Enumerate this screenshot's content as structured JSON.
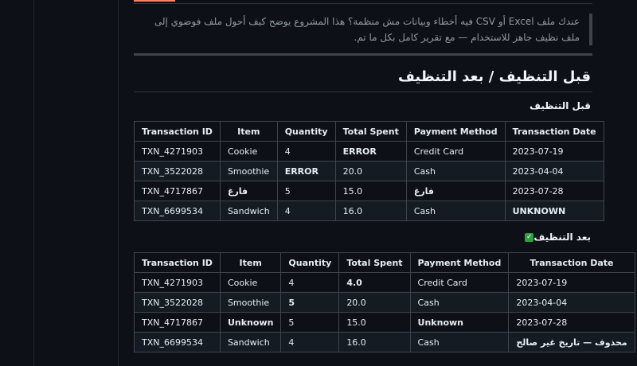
{
  "intro": "عندك ملف Excel أو CSV فيه أخطاء وبيانات مش منظمة؟ هذا المشروع يوضح كيف أحول ملف فوضوي إلى ملف نظيف جاهز للاستخدام — مع تقرير كامل بكل ما تم.",
  "section_title": "قبل التنظيف / بعد التنظيف",
  "before": {
    "label": "قبل التنظيف",
    "headers": [
      "Transaction ID",
      "Item",
      "Quantity",
      "Total Spent",
      "Payment Method",
      "Transaction Date"
    ],
    "rows": [
      [
        "TXN_4271903",
        "Cookie",
        "4",
        "ERROR",
        "Credit Card",
        "2023-07-19"
      ],
      [
        "TXN_3522028",
        "Smoothie",
        "ERROR",
        "20.0",
        "Cash",
        "2023-04-04"
      ],
      [
        "TXN_4717867",
        "فارغ",
        "5",
        "15.0",
        "فارغ",
        "2023-07-28"
      ],
      [
        "TXN_6699534",
        "Sandwich",
        "4",
        "16.0",
        "Cash",
        "UNKNOWN"
      ]
    ]
  },
  "after": {
    "label": "بعد التنظيف",
    "check_icon": "✓",
    "headers": [
      "Transaction ID",
      "Item",
      "Quantity",
      "Total Spent",
      "Payment Method",
      "Transaction Date"
    ],
    "rows": [
      [
        "TXN_4271903",
        "Cookie",
        "4",
        "4.0",
        "Credit Card",
        "2023-07-19"
      ],
      [
        "TXN_3522028",
        "Smoothie",
        "5",
        "20.0",
        "Cash",
        "2023-04-04"
      ],
      [
        "TXN_4717867",
        "Unknown",
        "5",
        "15.0",
        "Unknown",
        "2023-07-28"
      ],
      [
        "TXN_6699534",
        "Sandwich",
        "4",
        "16.0",
        "Cash",
        "محذوف — تاريخ غير صالح"
      ]
    ]
  }
}
